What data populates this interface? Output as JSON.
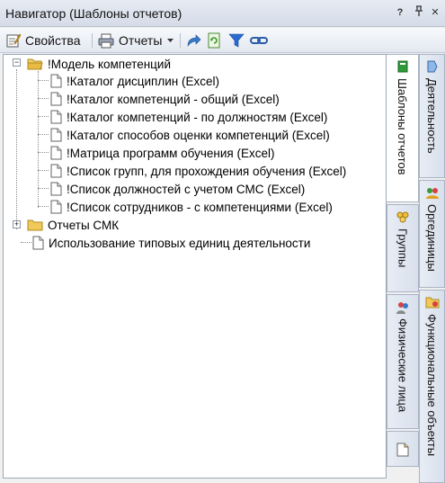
{
  "window": {
    "title": "Навигатор (Шаблоны отчетов)",
    "btn_help": "?",
    "btn_pin": "ᵖ",
    "btn_close": "✕"
  },
  "toolbar": {
    "properties_label": "Свойства",
    "reports_label": "Отчеты",
    "icons": [
      "properties-icon",
      "printer-icon",
      "dropdown-arrow-icon",
      "redo-icon",
      "refresh-icon",
      "filter-icon",
      "link-icon"
    ]
  },
  "tree": {
    "root1": {
      "label": "!Модель компетенций",
      "children": [
        "!Каталог дисциплин (Excel)",
        "!Каталог компетенций - общий (Excel)",
        "!Каталог компетенций - по должностям (Excel)",
        "!Каталог способов оценки компетенций (Excel)",
        "!Матрица программ обучения (Excel)",
        "!Список групп, для прохождения обучения (Excel)",
        "!Список должностей с учетом СМС (Excel)",
        "!Список сотрудников - с компетенциями (Excel)"
      ]
    },
    "root2": {
      "label": "Отчеты СМК"
    },
    "root3": {
      "label": "Использование типовых единиц деятельности"
    }
  },
  "tabs_inner": [
    {
      "label": "Шаблоны отчетов",
      "icon": "book-icon",
      "active": true
    },
    {
      "label": "Группы",
      "icon": "groups-icon",
      "active": false
    },
    {
      "label": "Физические лица",
      "icon": "persons-icon",
      "active": false
    }
  ],
  "tabs_outer": [
    {
      "label": "Деятельность",
      "icon": "activity-icon"
    },
    {
      "label": "Оргединицы",
      "icon": "org-units-icon"
    },
    {
      "label": "Функциональные объекты",
      "icon": "functional-objects-icon"
    }
  ],
  "colors": {
    "folder": "#e8c25a",
    "accent": "#2a5aa8"
  }
}
